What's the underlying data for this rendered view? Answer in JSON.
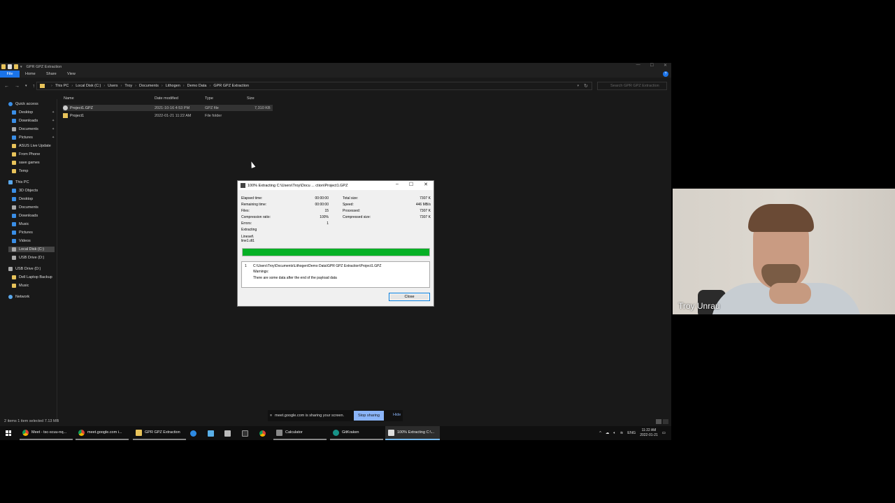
{
  "explorer": {
    "title": "GPR GPZ Extraction",
    "ribbon_tabs": [
      "File",
      "Home",
      "Share",
      "View"
    ],
    "breadcrumb": [
      "This PC",
      "Local Disk (C:)",
      "Users",
      "Troy",
      "Documents",
      "Lithogen",
      "Demo Data",
      "GPR GPZ Extraction"
    ],
    "search_placeholder": "Search GPR GPZ Extraction",
    "columns": [
      "Name",
      "Date modified",
      "Type",
      "Size"
    ],
    "files": [
      {
        "name": "Project1.GPZ",
        "date": "2021-10-16 4:53 PM",
        "type": "GPZ file",
        "size": "7,310 KB"
      },
      {
        "name": "Project1",
        "date": "2022-01-21 11:22 AM",
        "type": "File folder",
        "size": ""
      }
    ],
    "nav": [
      {
        "label": "Quick access",
        "icon": "star-icon"
      },
      {
        "label": "Desktop",
        "icon": "desktop-icon",
        "pinned": true
      },
      {
        "label": "Downloads",
        "icon": "download-icon",
        "pinned": true
      },
      {
        "label": "Documents",
        "icon": "documents-icon",
        "pinned": true
      },
      {
        "label": "Pictures",
        "icon": "pictures-icon",
        "pinned": true
      },
      {
        "label": "ASUS Live Update",
        "icon": "folder-icon"
      },
      {
        "label": "From Phone",
        "icon": "folder-icon"
      },
      {
        "label": "save games",
        "icon": "folder-icon"
      },
      {
        "label": "Temp",
        "icon": "folder-icon"
      },
      {
        "label": "This PC",
        "icon": "pc-icon"
      },
      {
        "label": "3D Objects",
        "icon": "3d-objects-icon"
      },
      {
        "label": "Desktop",
        "icon": "desktop-icon"
      },
      {
        "label": "Documents",
        "icon": "documents-icon"
      },
      {
        "label": "Downloads",
        "icon": "download-icon"
      },
      {
        "label": "Music",
        "icon": "music-icon"
      },
      {
        "label": "Pictures",
        "icon": "pictures-icon"
      },
      {
        "label": "Videos",
        "icon": "videos-icon"
      },
      {
        "label": "Local Disk (C:)",
        "icon": "disk-icon"
      },
      {
        "label": "USB Drive (D:)",
        "icon": "usb-drive-icon"
      },
      {
        "label": "USB Drive (D:)",
        "icon": "usb-drive-icon"
      },
      {
        "label": "Dell Laptop Backup",
        "icon": "folder-icon"
      },
      {
        "label": "Music",
        "icon": "folder-icon"
      },
      {
        "label": "Network",
        "icon": "network-icon"
      }
    ],
    "status": "2 items   1 item selected  7.13 MB"
  },
  "dialog": {
    "title": "100% Extracting C:\\Users\\Troy\\Docu ... ction\\Project1.GPZ",
    "left_stats": [
      {
        "label": "Elapsed time:",
        "value": "00:00:00"
      },
      {
        "label": "Remaining time:",
        "value": "00:00:00"
      },
      {
        "label": "Files:",
        "value": "15"
      },
      {
        "label": "Compression ratio:",
        "value": "100%"
      },
      {
        "label": "Errors:",
        "value": "1"
      }
    ],
    "right_stats": [
      {
        "label": "Total size:",
        "value": "7307 K"
      },
      {
        "label": "Speed:",
        "value": "446 MB/s"
      },
      {
        "label": "Processed:",
        "value": "7307 K"
      },
      {
        "label": "Compressed size:",
        "value": "7307 K"
      }
    ],
    "extracting_label": "Extracting",
    "current_file_1": "Lineset\\",
    "current_file_2": "line1.dt1",
    "progress": 1.0,
    "progress_color": "#06b025",
    "message_index": "1",
    "message_path": "C:\\Users\\Troy\\Documents\\Lithogen\\Demo Data\\GPR GPZ Extraction\\Project1.GPZ",
    "message_warnings": "Warnings:",
    "message_text": "There are some data after the end of the payload data",
    "close_label": "Close"
  },
  "sharebar": {
    "text": "meet.google.com is sharing your screen.",
    "stop_label": "Stop sharing",
    "hide_label": "Hide"
  },
  "taskbar": {
    "items": [
      {
        "label": "Meet - tsc-scuu-nq...",
        "icon": "chrome-icon"
      },
      {
        "label": "meet.google.com i...",
        "icon": "chrome-icon"
      },
      {
        "label": "GPR GPZ Extraction",
        "icon": "folder-icon"
      },
      {
        "label": "Calculator",
        "icon": "calculator-icon"
      },
      {
        "label": "GitKraken",
        "icon": "gitkraken-icon"
      },
      {
        "label": "100% Extracting C:\\...",
        "icon": "7zip-icon"
      }
    ],
    "lang": "ENG",
    "time": "11:22 AM",
    "date": "2022-01-21"
  },
  "video": {
    "participant": "Troy Unrau"
  }
}
